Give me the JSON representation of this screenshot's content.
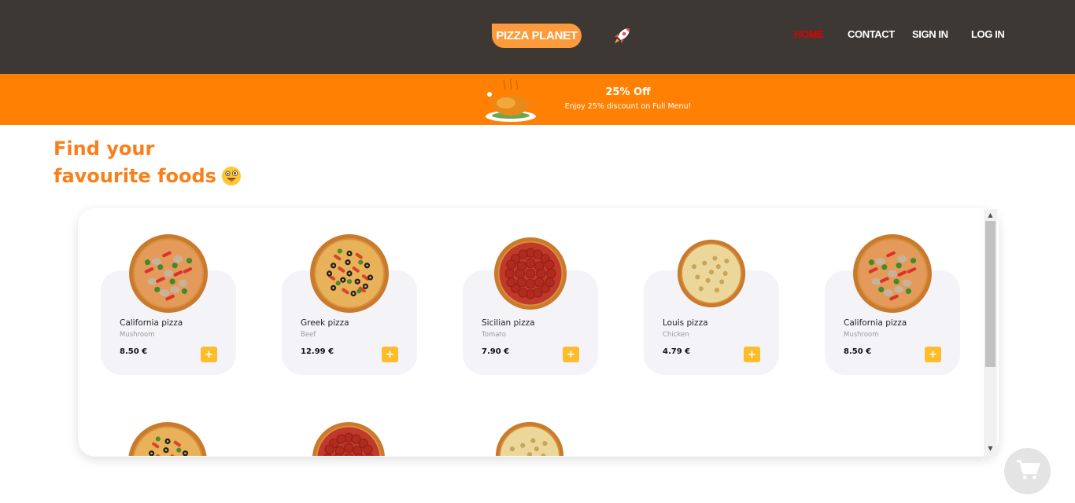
{
  "header": {
    "brand": "PIZZA PLANET",
    "nav": [
      {
        "label": "HOME",
        "active": true
      },
      {
        "label": "CONTACT",
        "active": false
      },
      {
        "label": "SIGN IN",
        "active": false
      },
      {
        "label": "LOG IN",
        "active": false
      }
    ]
  },
  "promo": {
    "title": "25% Off",
    "subtitle": "Enjoy 25% discount on Full Menu!"
  },
  "hero": {
    "line1": "Find your",
    "line2": "favourite foods"
  },
  "products": [
    {
      "name": "California pizza",
      "category": "Mushroom",
      "price": "8.50 €",
      "add_label": "+",
      "style": "veggie"
    },
    {
      "name": "Greek pizza",
      "category": "Beef",
      "price": "12.99 €",
      "add_label": "+",
      "style": "olive"
    },
    {
      "name": "Sicilian pizza",
      "category": "Tomato",
      "price": "7.90 €",
      "add_label": "+",
      "style": "pepperoni"
    },
    {
      "name": "Louis pizza",
      "category": "Chicken",
      "price": "4.79 €",
      "add_label": "+",
      "style": "cheese"
    },
    {
      "name": "California pizza",
      "category": "Mushroom",
      "price": "8.50 €",
      "add_label": "+",
      "style": "veggie"
    }
  ],
  "colors": {
    "header_bg": "#3e3834",
    "brand_pill": "#fd9a3c",
    "nav_active": "#e10000",
    "promo_bg": "#ff8003",
    "heading": "#f7801a",
    "card_bg": "#f4f3f8",
    "add_button": "#fdbc2c"
  },
  "icons": {
    "rocket": "rocket-icon",
    "turkey": "roast-turkey-icon",
    "emoji": "winking-tongue-face-icon",
    "cart": "shopping-cart-icon"
  }
}
